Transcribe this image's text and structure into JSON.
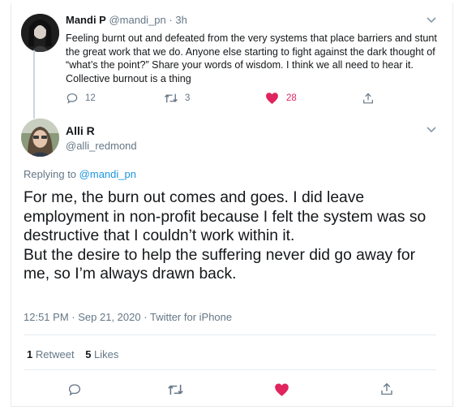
{
  "parent_tweet": {
    "author_name": "Mandi P",
    "handle": "@mandi_pn",
    "separator": "·",
    "time_ago": "3h",
    "text": "Feeling burnt out and defeated from the very systems that place barriers and stunt the great work that we do. Anyone else starting to fight against the dark thought of “what’s the point?” Share your words of wisdom. I think we all need to hear it. Collective burnout is a thing",
    "reply_count": "12",
    "retweet_count": "3",
    "like_count": "28"
  },
  "main_tweet": {
    "author_name": "Alli R",
    "handle": "@alli_redmond",
    "replying_prefix": "Replying to",
    "replying_to": "@mandi_pn",
    "text": "For me, the burn out comes and goes. I did leave employment in non-profit because I felt the system was so destructive that I couldn’t work within it.\nBut the desire to help the suffering never did go away for me, so I’m always drawn back.",
    "time": "12:51 PM",
    "date": "Sep 21, 2020",
    "source": "Twitter for iPhone",
    "meta_separator": "·",
    "retweet_count": "1",
    "retweet_label": "Retweet",
    "like_count": "5",
    "like_label": "Likes"
  },
  "colors": {
    "like_active": "#e0245e",
    "link": "#1b95e0",
    "muted": "#657786",
    "text": "#14171a"
  },
  "icons": [
    "reply-icon",
    "retweet-icon",
    "like-icon",
    "share-icon",
    "chevron-down-icon"
  ]
}
